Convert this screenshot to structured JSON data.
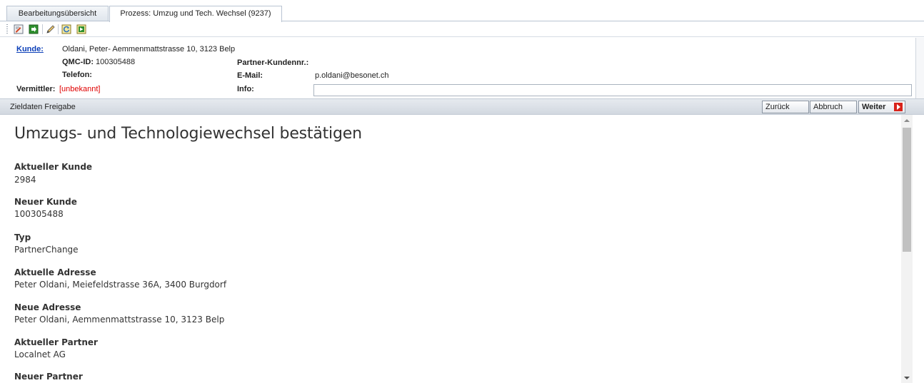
{
  "tabs": [
    {
      "label": "Bearbeitungsübersicht",
      "active": false
    },
    {
      "label": "Prozess: Umzug und Tech. Wechsel (9237)",
      "active": true
    }
  ],
  "toolbar": {
    "icons": [
      "edit-icon",
      "forward-icon",
      "pencil-icon",
      "refresh-icon",
      "go-icon"
    ]
  },
  "customer": {
    "kunde_label": "Kunde:",
    "kunde_value": "Oldani, Peter- Aemmenmattstrasse 10, 3123 Belp",
    "qmc_label": "QMC-ID:",
    "qmc_value": "100305488",
    "telefon_label": "Telefon:",
    "telefon_value": "",
    "vermittler_label": "Vermittler:",
    "vermittler_value": "[unbekannt]",
    "partner_kundennr_label": "Partner-Kundennr.:",
    "partner_kundennr_value": "",
    "email_label": "E-Mail:",
    "email_value": "p.oldani@besonet.ch",
    "info_label": "Info:",
    "info_value": ""
  },
  "section": {
    "title": "Zieldaten Freigabe",
    "back_label": "Zurück",
    "cancel_label": "Abbruch",
    "next_label": "Weiter"
  },
  "content": {
    "heading": "Umzugs- und Technologiewechsel bestätigen",
    "fields": [
      {
        "label": "Aktueller Kunde",
        "value": "2984"
      },
      {
        "label": "Neuer Kunde",
        "value": "100305488"
      },
      {
        "label": "Typ",
        "value": "PartnerChange"
      },
      {
        "label": "Aktuelle Adresse",
        "value": "Peter Oldani, Meiefeldstrasse 36A, 3400 Burgdorf"
      },
      {
        "label": "Neue Adresse",
        "value": "Peter Oldani, Aemmenmattstrasse 10, 3123 Belp"
      },
      {
        "label": "Aktueller Partner",
        "value": "Localnet AG"
      },
      {
        "label": "Neuer Partner",
        "value": ""
      }
    ]
  },
  "colors": {
    "link": "#0b3fb8",
    "unknown_red": "#e00000",
    "next_arrow": "#d8231b"
  }
}
